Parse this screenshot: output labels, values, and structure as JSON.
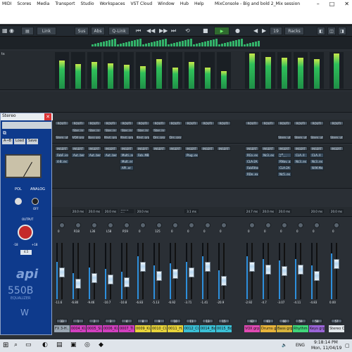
{
  "menubar": {
    "items": [
      "MIDI",
      "Scores",
      "Media",
      "Transport",
      "Studio",
      "Workspaces",
      "VST Cloud",
      "Window",
      "Hub",
      "Help"
    ],
    "title": "MixConsole - Big and bold 2_Mix session"
  },
  "toolbar": {
    "link": "Link",
    "sus": "Sus",
    "abs": "Abs",
    "qlink": "Q-Link",
    "page": "19",
    "racks": "Racks"
  },
  "plugin": {
    "title": "Stereo",
    "preset_tabs": [
      "A→B",
      "Load",
      "Save"
    ],
    "brand": "api",
    "model": "550B",
    "subtitle": "EQUALIZER",
    "labels": [
      "POL",
      "ANALOG",
      "OFF",
      "OUTPUT",
      "-18",
      "+18",
      "4.5"
    ]
  },
  "routing_label": "ROUTI",
  "inserts_label": "INSERT",
  "routing_row1": [
    "Ster..in",
    "Ster..in",
    "Ster..in",
    "Ster..in",
    "Ster..in",
    "Ster..in"
  ],
  "routing_row2": [
    "Stere..ut",
    "VOX grp",
    "Bass grp",
    "Rhyt..grp",
    "Rhyt..grp",
    "Rhyt..grp",
    "Drs..grp",
    "Drs..grp",
    "Stere..ut",
    "Stere..ut",
    "Stere..ut",
    "Stere..ut"
  ],
  "insert_cols": [
    [
      "FabF..ier",
      "4-B..ex"
    ],
    [
      "Aut..ber"
    ],
    [
      "Aut..ber"
    ],
    [
      "Aut..ber"
    ],
    [
      "Multi..ar",
      "Mult..er",
      "API..er"
    ],
    [
      "Fab..MB"
    ],
    [],
    [],
    [
      "Plug..ex"
    ],
    [],
    [],
    [
      "RCo..ex",
      "CLA-2A",
      "FabFilter",
      "RDe..ex"
    ],
    [
      "Nc3..ex"
    ],
    [
      "Ce 5..ex",
      "RNav..ax",
      "CLA-2A",
      "Nc5..ex"
    ],
    [
      "CLA..ll",
      "Nc3..ex"
    ],
    [
      "CLA..ll",
      "Nc3..ex",
      "W.M.Me"
    ]
  ],
  "delays": [
    "20.0 ms",
    "20.0 ms",
    "20.0 ms",
    "115.4 ms",
    "20.0 ms",
    "3.1 ms",
    "24.7 ms",
    "20.0 ms",
    "20.0 ms",
    "20.0 ms",
    "20.0 ms"
  ],
  "pan_values": [
    "0",
    "R18",
    "L36",
    "L58",
    "R59",
    "0",
    "125",
    "0",
    "0",
    "0",
    "0",
    "0",
    "0",
    "0",
    "0",
    "0",
    "0"
  ],
  "channels": [
    {
      "name": "FX 3-H..",
      "level": "-11.6",
      "ro": "33",
      "color": "#9aa6b2"
    },
    {
      "name": "0004_Kl..",
      "level": "-6.80",
      "ro": "1",
      "color": "#d23fbf"
    },
    {
      "name": "0005_Sl..",
      "level": "-9.46",
      "ro": "2",
      "color": "#d23fbf"
    },
    {
      "name": "0006_Kl..",
      "level": "-10.7",
      "ro": "3",
      "color": "#d23fbf"
    },
    {
      "name": "0007_Ti..",
      "level": "-10.8",
      "ro": "4",
      "color": "#d23fbf"
    },
    {
      "name": "0009_Ki..",
      "level": "-6.83",
      "ro": "8",
      "color": "#e8d43a"
    },
    {
      "name": "0010_Cl..",
      "level": "-5.13",
      "ro": "9",
      "color": "#e8d43a"
    },
    {
      "name": "0011_H..",
      "level": "-6.92",
      "ro": "10",
      "color": "#e8d43a"
    },
    {
      "name": "0012_Cl..",
      "level": "-3.71",
      "ro": "11",
      "color": "#3ac0d6"
    },
    {
      "name": "0014_Bo..",
      "level": "-1.41",
      "ro": "13",
      "color": "#3ac0d6"
    },
    {
      "name": "0015_Bo..",
      "level": "-20.9",
      "ro": "15",
      "color": "#3ac0d6"
    },
    {
      "name": "VOX grp",
      "level": "-2.92",
      "ro": "62",
      "color": "#e04ab3"
    },
    {
      "name": "Drums g..",
      "level": "-4.7",
      "ro": "61",
      "color": "#e8b43a"
    },
    {
      "name": "Bass grp",
      "level": "-3.07",
      "ro": "60",
      "color": "#d6b33c"
    },
    {
      "name": "Rhythm",
      "level": "-4.11",
      "ro": "59",
      "color": "#3fd67a"
    },
    {
      "name": "Keys grp",
      "level": "-4.83",
      "ro": "58",
      "color": "#9a65d8"
    },
    {
      "name": "Stereo O..",
      "level": "0.00",
      "ro": "57",
      "color": "#e3e8ec"
    }
  ],
  "taskbar": {
    "lang": "ENG",
    "time": "9:18:14 PM",
    "date": "Mon, 11/04/19"
  }
}
